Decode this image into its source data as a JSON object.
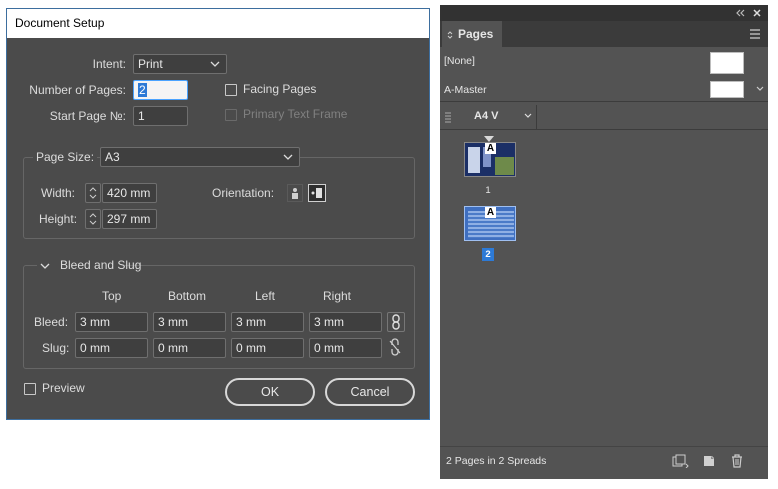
{
  "dialog": {
    "title": "Document Setup",
    "intent_label": "Intent:",
    "intent_value": "Print",
    "num_pages_label": "Number of Pages:",
    "num_pages_value": "2",
    "start_page_label": "Start Page №:",
    "start_page_value": "1",
    "facing_pages_label": "Facing Pages",
    "facing_pages_checked": false,
    "primary_text_frame_label": "Primary Text Frame",
    "primary_text_frame_checked": false,
    "page_size_label": "Page Size:",
    "page_size_value": "A3",
    "width_label": "Width:",
    "width_value": "420 mm",
    "height_label": "Height:",
    "height_value": "297 mm",
    "orientation_label": "Orientation:",
    "orientation_selected": "landscape",
    "bleed_slug_label": "Bleed and Slug",
    "columns": [
      "Top",
      "Bottom",
      "Left",
      "Right"
    ],
    "bleed_label": "Bleed:",
    "bleed_values": [
      "3 mm",
      "3 mm",
      "3 mm",
      "3 mm"
    ],
    "slug_label": "Slug:",
    "slug_values": [
      "0 mm",
      "0 mm",
      "0 mm",
      "0 mm"
    ],
    "preview_label": "Preview",
    "preview_checked": false,
    "ok_label": "OK",
    "cancel_label": "Cancel"
  },
  "pages_panel": {
    "tab_label": "Pages",
    "masters": [
      "[None]",
      "A-Master"
    ],
    "page_size_menu": "A4 V",
    "pages": [
      {
        "number": "1",
        "master_prefix": "A",
        "selected": false
      },
      {
        "number": "2",
        "master_prefix": "A",
        "selected": true
      }
    ],
    "status_text": "2 Pages in 2 Spreads"
  },
  "colors": {
    "dialog_bg": "#4b4b4b",
    "panel_bg": "#535353",
    "selection_blue": "#2d7ad6",
    "field_bg": "#3f3f3f"
  },
  "icons": [
    "chevron-down-icon",
    "checkbox-icon",
    "portrait-icon",
    "landscape-icon",
    "chain-link-icon",
    "chain-broken-icon",
    "double-chevron-left-icon",
    "close-icon",
    "panel-menu-icon",
    "edit-page-size-icon",
    "new-page-icon",
    "delete-page-icon"
  ]
}
